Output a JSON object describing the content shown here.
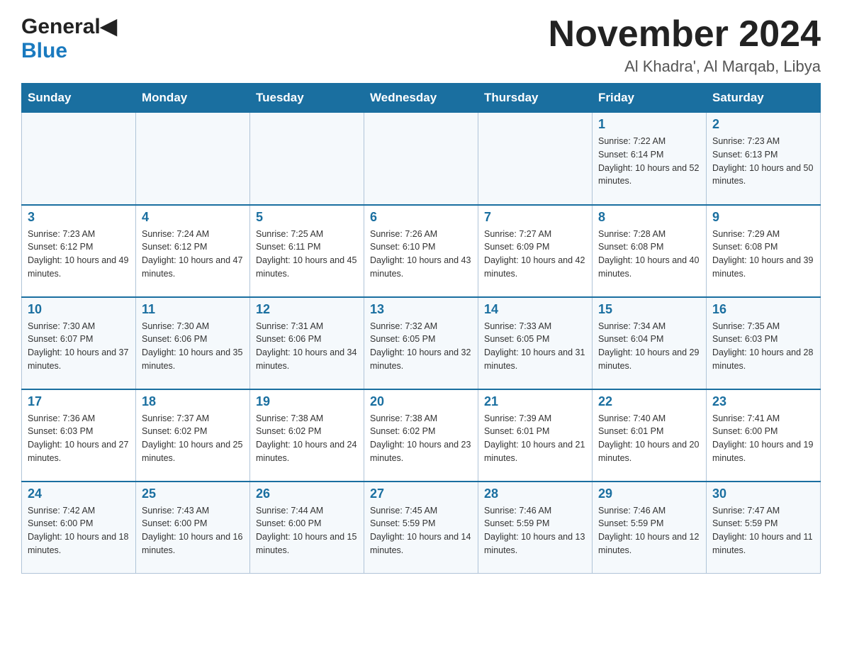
{
  "header": {
    "logo_general": "General",
    "logo_blue": "Blue",
    "title": "November 2024",
    "subtitle": "Al Khadra', Al Marqab, Libya"
  },
  "days_of_week": [
    "Sunday",
    "Monday",
    "Tuesday",
    "Wednesday",
    "Thursday",
    "Friday",
    "Saturday"
  ],
  "weeks": [
    [
      {
        "day": "",
        "sunrise": "",
        "sunset": "",
        "daylight": ""
      },
      {
        "day": "",
        "sunrise": "",
        "sunset": "",
        "daylight": ""
      },
      {
        "day": "",
        "sunrise": "",
        "sunset": "",
        "daylight": ""
      },
      {
        "day": "",
        "sunrise": "",
        "sunset": "",
        "daylight": ""
      },
      {
        "day": "",
        "sunrise": "",
        "sunset": "",
        "daylight": ""
      },
      {
        "day": "1",
        "sunrise": "Sunrise: 7:22 AM",
        "sunset": "Sunset: 6:14 PM",
        "daylight": "Daylight: 10 hours and 52 minutes."
      },
      {
        "day": "2",
        "sunrise": "Sunrise: 7:23 AM",
        "sunset": "Sunset: 6:13 PM",
        "daylight": "Daylight: 10 hours and 50 minutes."
      }
    ],
    [
      {
        "day": "3",
        "sunrise": "Sunrise: 7:23 AM",
        "sunset": "Sunset: 6:12 PM",
        "daylight": "Daylight: 10 hours and 49 minutes."
      },
      {
        "day": "4",
        "sunrise": "Sunrise: 7:24 AM",
        "sunset": "Sunset: 6:12 PM",
        "daylight": "Daylight: 10 hours and 47 minutes."
      },
      {
        "day": "5",
        "sunrise": "Sunrise: 7:25 AM",
        "sunset": "Sunset: 6:11 PM",
        "daylight": "Daylight: 10 hours and 45 minutes."
      },
      {
        "day": "6",
        "sunrise": "Sunrise: 7:26 AM",
        "sunset": "Sunset: 6:10 PM",
        "daylight": "Daylight: 10 hours and 43 minutes."
      },
      {
        "day": "7",
        "sunrise": "Sunrise: 7:27 AM",
        "sunset": "Sunset: 6:09 PM",
        "daylight": "Daylight: 10 hours and 42 minutes."
      },
      {
        "day": "8",
        "sunrise": "Sunrise: 7:28 AM",
        "sunset": "Sunset: 6:08 PM",
        "daylight": "Daylight: 10 hours and 40 minutes."
      },
      {
        "day": "9",
        "sunrise": "Sunrise: 7:29 AM",
        "sunset": "Sunset: 6:08 PM",
        "daylight": "Daylight: 10 hours and 39 minutes."
      }
    ],
    [
      {
        "day": "10",
        "sunrise": "Sunrise: 7:30 AM",
        "sunset": "Sunset: 6:07 PM",
        "daylight": "Daylight: 10 hours and 37 minutes."
      },
      {
        "day": "11",
        "sunrise": "Sunrise: 7:30 AM",
        "sunset": "Sunset: 6:06 PM",
        "daylight": "Daylight: 10 hours and 35 minutes."
      },
      {
        "day": "12",
        "sunrise": "Sunrise: 7:31 AM",
        "sunset": "Sunset: 6:06 PM",
        "daylight": "Daylight: 10 hours and 34 minutes."
      },
      {
        "day": "13",
        "sunrise": "Sunrise: 7:32 AM",
        "sunset": "Sunset: 6:05 PM",
        "daylight": "Daylight: 10 hours and 32 minutes."
      },
      {
        "day": "14",
        "sunrise": "Sunrise: 7:33 AM",
        "sunset": "Sunset: 6:05 PM",
        "daylight": "Daylight: 10 hours and 31 minutes."
      },
      {
        "day": "15",
        "sunrise": "Sunrise: 7:34 AM",
        "sunset": "Sunset: 6:04 PM",
        "daylight": "Daylight: 10 hours and 29 minutes."
      },
      {
        "day": "16",
        "sunrise": "Sunrise: 7:35 AM",
        "sunset": "Sunset: 6:03 PM",
        "daylight": "Daylight: 10 hours and 28 minutes."
      }
    ],
    [
      {
        "day": "17",
        "sunrise": "Sunrise: 7:36 AM",
        "sunset": "Sunset: 6:03 PM",
        "daylight": "Daylight: 10 hours and 27 minutes."
      },
      {
        "day": "18",
        "sunrise": "Sunrise: 7:37 AM",
        "sunset": "Sunset: 6:02 PM",
        "daylight": "Daylight: 10 hours and 25 minutes."
      },
      {
        "day": "19",
        "sunrise": "Sunrise: 7:38 AM",
        "sunset": "Sunset: 6:02 PM",
        "daylight": "Daylight: 10 hours and 24 minutes."
      },
      {
        "day": "20",
        "sunrise": "Sunrise: 7:38 AM",
        "sunset": "Sunset: 6:02 PM",
        "daylight": "Daylight: 10 hours and 23 minutes."
      },
      {
        "day": "21",
        "sunrise": "Sunrise: 7:39 AM",
        "sunset": "Sunset: 6:01 PM",
        "daylight": "Daylight: 10 hours and 21 minutes."
      },
      {
        "day": "22",
        "sunrise": "Sunrise: 7:40 AM",
        "sunset": "Sunset: 6:01 PM",
        "daylight": "Daylight: 10 hours and 20 minutes."
      },
      {
        "day": "23",
        "sunrise": "Sunrise: 7:41 AM",
        "sunset": "Sunset: 6:00 PM",
        "daylight": "Daylight: 10 hours and 19 minutes."
      }
    ],
    [
      {
        "day": "24",
        "sunrise": "Sunrise: 7:42 AM",
        "sunset": "Sunset: 6:00 PM",
        "daylight": "Daylight: 10 hours and 18 minutes."
      },
      {
        "day": "25",
        "sunrise": "Sunrise: 7:43 AM",
        "sunset": "Sunset: 6:00 PM",
        "daylight": "Daylight: 10 hours and 16 minutes."
      },
      {
        "day": "26",
        "sunrise": "Sunrise: 7:44 AM",
        "sunset": "Sunset: 6:00 PM",
        "daylight": "Daylight: 10 hours and 15 minutes."
      },
      {
        "day": "27",
        "sunrise": "Sunrise: 7:45 AM",
        "sunset": "Sunset: 5:59 PM",
        "daylight": "Daylight: 10 hours and 14 minutes."
      },
      {
        "day": "28",
        "sunrise": "Sunrise: 7:46 AM",
        "sunset": "Sunset: 5:59 PM",
        "daylight": "Daylight: 10 hours and 13 minutes."
      },
      {
        "day": "29",
        "sunrise": "Sunrise: 7:46 AM",
        "sunset": "Sunset: 5:59 PM",
        "daylight": "Daylight: 10 hours and 12 minutes."
      },
      {
        "day": "30",
        "sunrise": "Sunrise: 7:47 AM",
        "sunset": "Sunset: 5:59 PM",
        "daylight": "Daylight: 10 hours and 11 minutes."
      }
    ]
  ]
}
